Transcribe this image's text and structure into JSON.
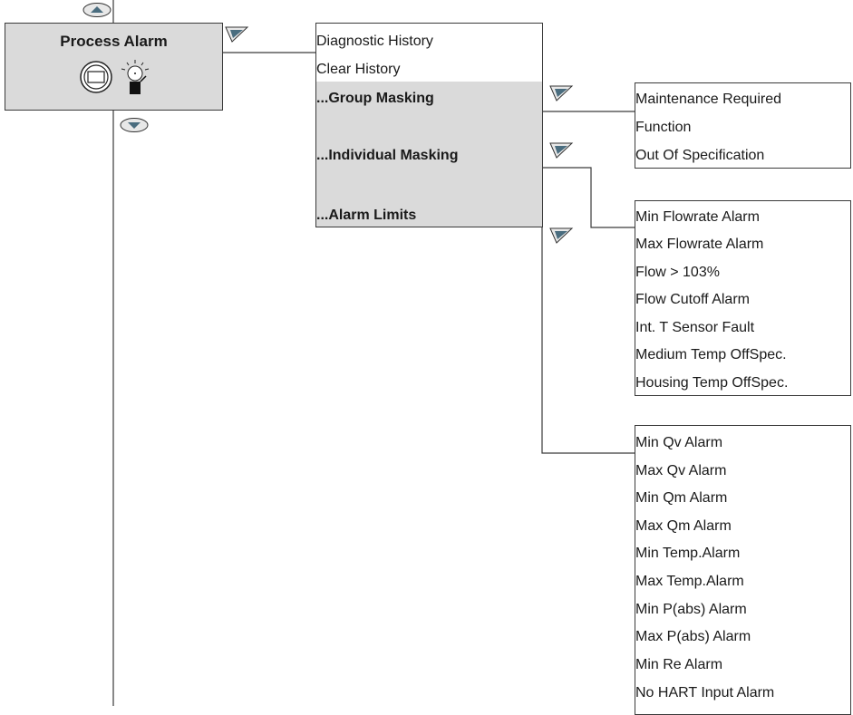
{
  "process_alarm": {
    "title": "Process Alarm",
    "icon": "transmitter-with-alarm-lamp-icon"
  },
  "nav_icons": {
    "up": "up-arrow-button-icon",
    "down": "down-arrow-button-icon",
    "enter": "enter-arrow-button-icon"
  },
  "submenu": {
    "items": [
      {
        "label": "Diagnostic History"
      },
      {
        "label": "Clear History"
      },
      {
        "label": "...Group Masking"
      },
      {
        "label": "...Individual Masking"
      },
      {
        "label": "...Alarm Limits"
      }
    ]
  },
  "group_masking": {
    "items": [
      "Maintenance Required",
      "Function",
      "Out Of  Specification"
    ]
  },
  "individual_masking": {
    "items": [
      "Min Flowrate Alarm",
      "Max Flowrate Alarm",
      "Flow > 103%",
      "Flow Cutoff Alarm",
      "Int. T Sensor Fault",
      "Medium Temp OffSpec.",
      "Housing Temp OffSpec."
    ]
  },
  "alarm_limits": {
    "items": [
      "Min Qv Alarm",
      "Max Qv Alarm",
      "Min Qm Alarm",
      "Max Qm Alarm",
      "Min Temp.Alarm",
      "Max Temp.Alarm",
      "Min P(abs) Alarm",
      "Max P(abs) Alarm",
      "Min Re Alarm",
      "No HART Input Alarm"
    ]
  },
  "colors": {
    "box_gray": "#dadada",
    "arrow_key_fill": "#4a6d7f",
    "line": "#3a3a3a"
  }
}
